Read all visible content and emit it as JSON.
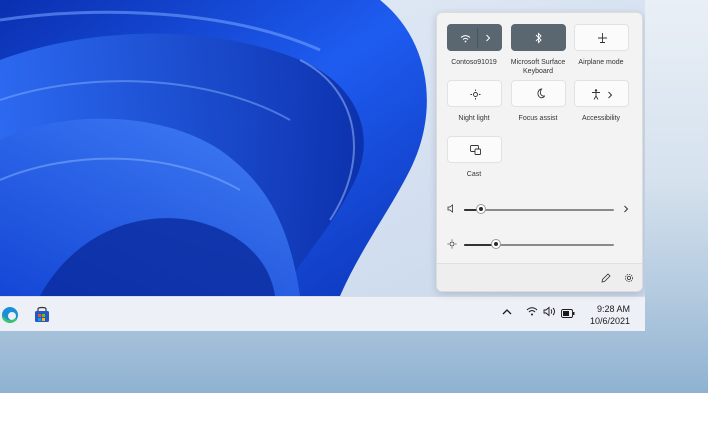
{
  "quick_settings": {
    "tiles": [
      {
        "label": "Contoso91019",
        "icon": "wifi-icon",
        "state": "on",
        "has_chevron": true
      },
      {
        "label": "Microsoft Surface Keyboard",
        "icon": "bluetooth-icon",
        "state": "on"
      },
      {
        "label": "Airplane mode",
        "icon": "airplane-icon",
        "state": "off"
      },
      {
        "label": "Night light",
        "icon": "night-light-icon",
        "state": "off"
      },
      {
        "label": "Focus assist",
        "icon": "moon-icon",
        "state": "off"
      },
      {
        "label": "Accessibility",
        "icon": "accessibility-icon",
        "state": "off",
        "has_chevron": true
      },
      {
        "label": "Cast",
        "icon": "cast-icon",
        "state": "off"
      }
    ],
    "volume": {
      "level": 0.12,
      "icon": "speaker-icon"
    },
    "brightness": {
      "level": 0.22,
      "icon": "sun-icon"
    },
    "footer": {
      "edit_icon": "pencil-icon",
      "settings_icon": "gear-icon"
    }
  },
  "taskbar": {
    "apps": [
      {
        "icon": "edge-icon"
      },
      {
        "icon": "store-icon"
      }
    ],
    "tray": {
      "chevron_icon": "chevron-up-icon",
      "network_icon": "wifi-icon",
      "volume_icon": "speaker-icon",
      "battery_icon": "battery-icon"
    },
    "clock": {
      "time": "9:28 AM",
      "date": "10/6/2021"
    }
  },
  "colors": {
    "accent_tile": "#5b6770",
    "wallpaper_blue": "#1f55e0",
    "taskbar": "#edf1f7"
  }
}
